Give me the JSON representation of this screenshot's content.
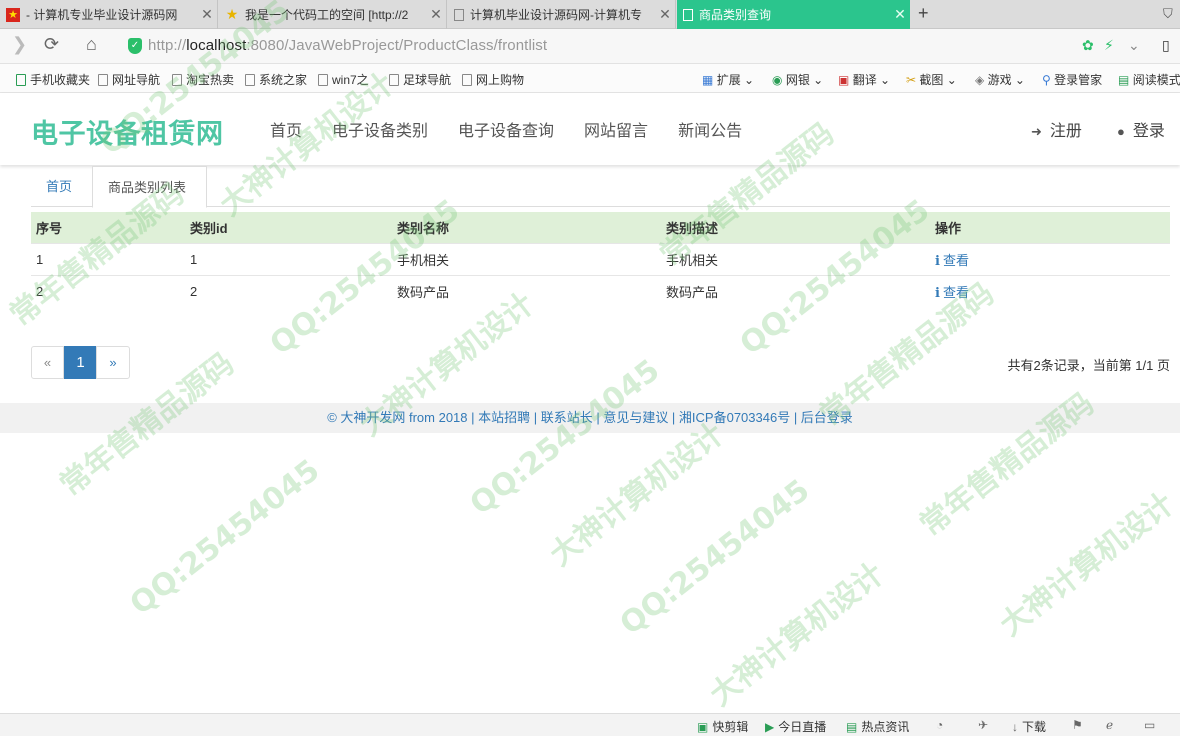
{
  "browser": {
    "tabs": [
      {
        "title": "- 计算机专业毕业设计源码网"
      },
      {
        "title": "我是一个代码工的空间 [http://2"
      },
      {
        "title": "计算机毕业设计源码网-计算机专"
      },
      {
        "title": "商品类别查询"
      }
    ],
    "new_tab": "+",
    "url_prefix": "http://",
    "url_host": "localhost",
    "url_rest": ":8080/JavaWebProject/ProductClass/frontlist",
    "bookmarks": [
      "手机收藏夹",
      "网址导航",
      "淘宝热卖",
      "系统之家",
      "win7之",
      "足球导航",
      "网上购物"
    ],
    "toolbar_right": [
      "扩展",
      "网银",
      "翻译",
      "截图",
      "游戏",
      "登录管家",
      "阅读模式"
    ]
  },
  "site": {
    "logo": "电子设备租赁网",
    "nav": [
      "首页",
      "电子设备类别",
      "电子设备查询",
      "网站留言",
      "新闻公告"
    ],
    "register": "注册",
    "login": "登录"
  },
  "content_tabs": [
    "首页",
    "商品类别列表"
  ],
  "table": {
    "headers": [
      "序号",
      "类别id",
      "类别名称",
      "类别描述",
      "操作"
    ],
    "rows": [
      {
        "no": "1",
        "id": "1",
        "name": "手机相关",
        "desc": "手机相关",
        "op": "查看"
      },
      {
        "no": "2",
        "id": "2",
        "name": "数码产品",
        "desc": "数码产品",
        "op": "查看"
      }
    ]
  },
  "pagination": {
    "prev": "«",
    "current": "1",
    "next": "»",
    "summary": "共有2条记录，当前第 1/1 页"
  },
  "footer": "© 大神开发网 from 2018 | 本站招聘 | 联系站长 | 意见与建议 | 湘ICP备0703346号 | 后台登录",
  "watermarks": [
    "QQ:25454045",
    "大神计算机设计",
    "常年售精品源码",
    "QQ:25454045",
    "大神计算机设计",
    "常年售精品源码",
    "QQ:25454045",
    "大神计算机设计",
    "常年售精品源码",
    "QQ:25454045",
    "常年售精品源码",
    "大神计算机设计",
    "QQ:25454045",
    "常年售精品源码",
    "QQ:25454045",
    "大神计算机设计"
  ],
  "statusbar": [
    "快剪辑",
    "今日直播",
    "热点资讯",
    "下载"
  ],
  "colors": {
    "tab_active": "#2bc58d",
    "logo": "#4fc6a4",
    "link": "#337ab7",
    "table_head": "#dff0d8"
  }
}
